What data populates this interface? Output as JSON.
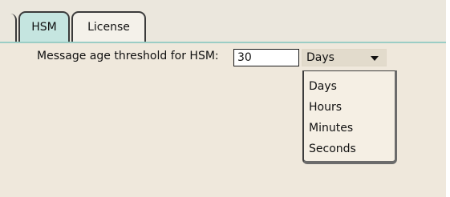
{
  "tabs": [
    {
      "label": "HSM",
      "selected": true
    },
    {
      "label": "License",
      "selected": false
    }
  ],
  "hsm": {
    "threshold_label": "Message age threshold for HSM:",
    "threshold_value": "30",
    "unit_selected": "Days",
    "unit_options": [
      "Days",
      "Hours",
      "Minutes",
      "Seconds"
    ]
  },
  "colors": {
    "active_tab": "#c5e5e0",
    "panel_background": "#efe8dc",
    "tab_underline": "#9bcdc5"
  }
}
